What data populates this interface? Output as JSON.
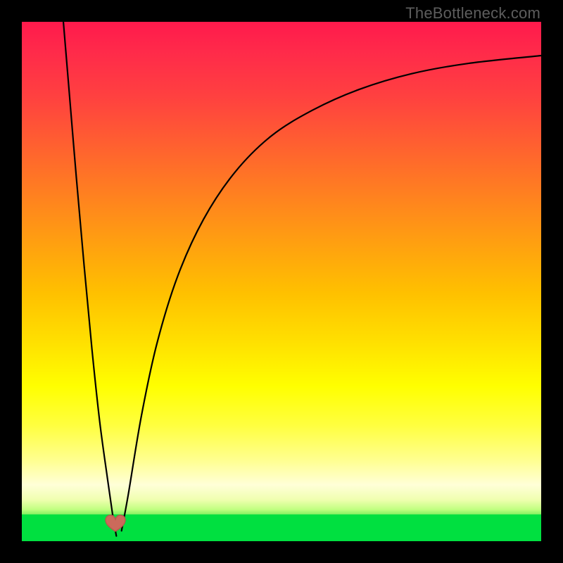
{
  "watermark": "TheBottleneck.com",
  "colors": {
    "curve_stroke": "#000000",
    "heart_fill": "#cc6a5b",
    "heart_stroke": "#b85a4c",
    "frame_bg": "#00e040"
  },
  "chart_data": {
    "type": "line",
    "title": "",
    "xlabel": "",
    "ylabel": "",
    "xlim": [
      0,
      100
    ],
    "ylim": [
      0,
      100
    ],
    "annotations": [
      {
        "kind": "heart-marker",
        "x": 18,
        "y": 2
      },
      {
        "kind": "watermark",
        "text": "TheBottleneck.com",
        "position": "top-right"
      }
    ],
    "series": [
      {
        "name": "left-branch",
        "x": [
          8.0,
          9.0,
          10.5,
          12.0,
          13.5,
          15.0,
          16.5,
          17.5,
          18.2
        ],
        "values": [
          100,
          88,
          70,
          53,
          37,
          23,
          12,
          5,
          1
        ]
      },
      {
        "name": "right-branch",
        "x": [
          19.2,
          20.5,
          23.0,
          26.0,
          30.0,
          35.0,
          41.0,
          48.0,
          56.0,
          65.0,
          75.0,
          86.0,
          100.0
        ],
        "values": [
          2,
          9,
          24,
          38,
          51,
          62,
          71,
          78,
          83,
          87,
          90,
          92,
          93.5
        ]
      }
    ]
  }
}
